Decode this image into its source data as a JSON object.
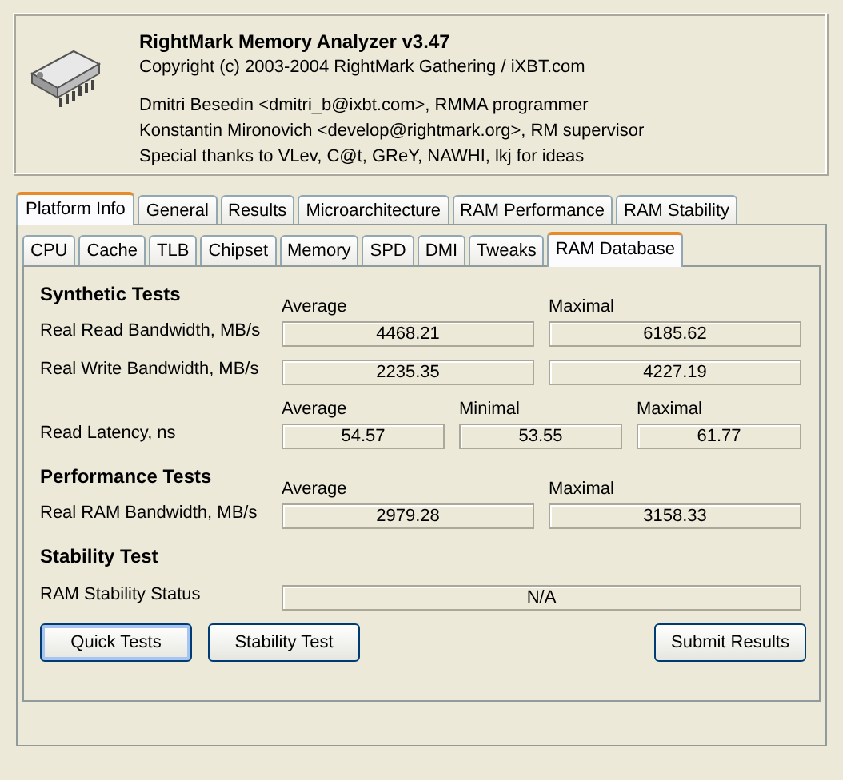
{
  "header": {
    "title": "RightMark Memory Analyzer v3.47",
    "copyright": "Copyright (c) 2003-2004 RightMark Gathering / iXBT.com",
    "credits": [
      "Dmitri Besedin <dmitri_b@ixbt.com>, RMMA programmer",
      "Konstantin Mironovich <develop@rightmark.org>, RM supervisor",
      "Special thanks to VLev, C@t, GReY, NAWHI, lkj for ideas"
    ]
  },
  "tabs": [
    {
      "label": "Platform Info",
      "selected": true
    },
    {
      "label": "General",
      "selected": false
    },
    {
      "label": "Results",
      "selected": false
    },
    {
      "label": "Microarchitecture",
      "selected": false
    },
    {
      "label": "RAM Performance",
      "selected": false
    },
    {
      "label": "RAM Stability",
      "selected": false
    }
  ],
  "subtabs": [
    {
      "label": "CPU",
      "selected": false
    },
    {
      "label": "Cache",
      "selected": false
    },
    {
      "label": "TLB",
      "selected": false
    },
    {
      "label": "Chipset",
      "selected": false
    },
    {
      "label": "Memory",
      "selected": false
    },
    {
      "label": "SPD",
      "selected": false
    },
    {
      "label": "DMI",
      "selected": false
    },
    {
      "label": "Tweaks",
      "selected": false
    },
    {
      "label": "RAM Database",
      "selected": true
    }
  ],
  "sections": [
    {
      "title": "Synthetic Tests",
      "rows": [
        {
          "headings": [
            "Average",
            "Maximal"
          ],
          "label": "Real Read Bandwidth, MB/s",
          "values": [
            "4468.21",
            "6185.62"
          ]
        },
        {
          "label": "Real Write Bandwidth, MB/s",
          "values": [
            "2235.35",
            "4227.19"
          ]
        },
        {
          "headings": [
            "Average",
            "Minimal",
            "Maximal"
          ],
          "label": "Read Latency, ns",
          "values": [
            "54.57",
            "53.55",
            "61.77"
          ]
        }
      ]
    },
    {
      "title": "Performance Tests",
      "rows": [
        {
          "headings": [
            "Average",
            "Maximal"
          ],
          "label": "Real RAM Bandwidth, MB/s",
          "values": [
            "2979.28",
            "3158.33"
          ]
        }
      ]
    },
    {
      "title": "Stability Test",
      "rows": [
        {
          "label": "RAM Stability Status",
          "values": [
            "N/A"
          ]
        }
      ]
    }
  ],
  "buttons_left": [
    {
      "label": "Quick Tests",
      "focused": true
    },
    {
      "label": "Stability Test",
      "focused": false
    }
  ],
  "buttons_right": [
    {
      "label": "Submit Results",
      "focused": false
    }
  ]
}
